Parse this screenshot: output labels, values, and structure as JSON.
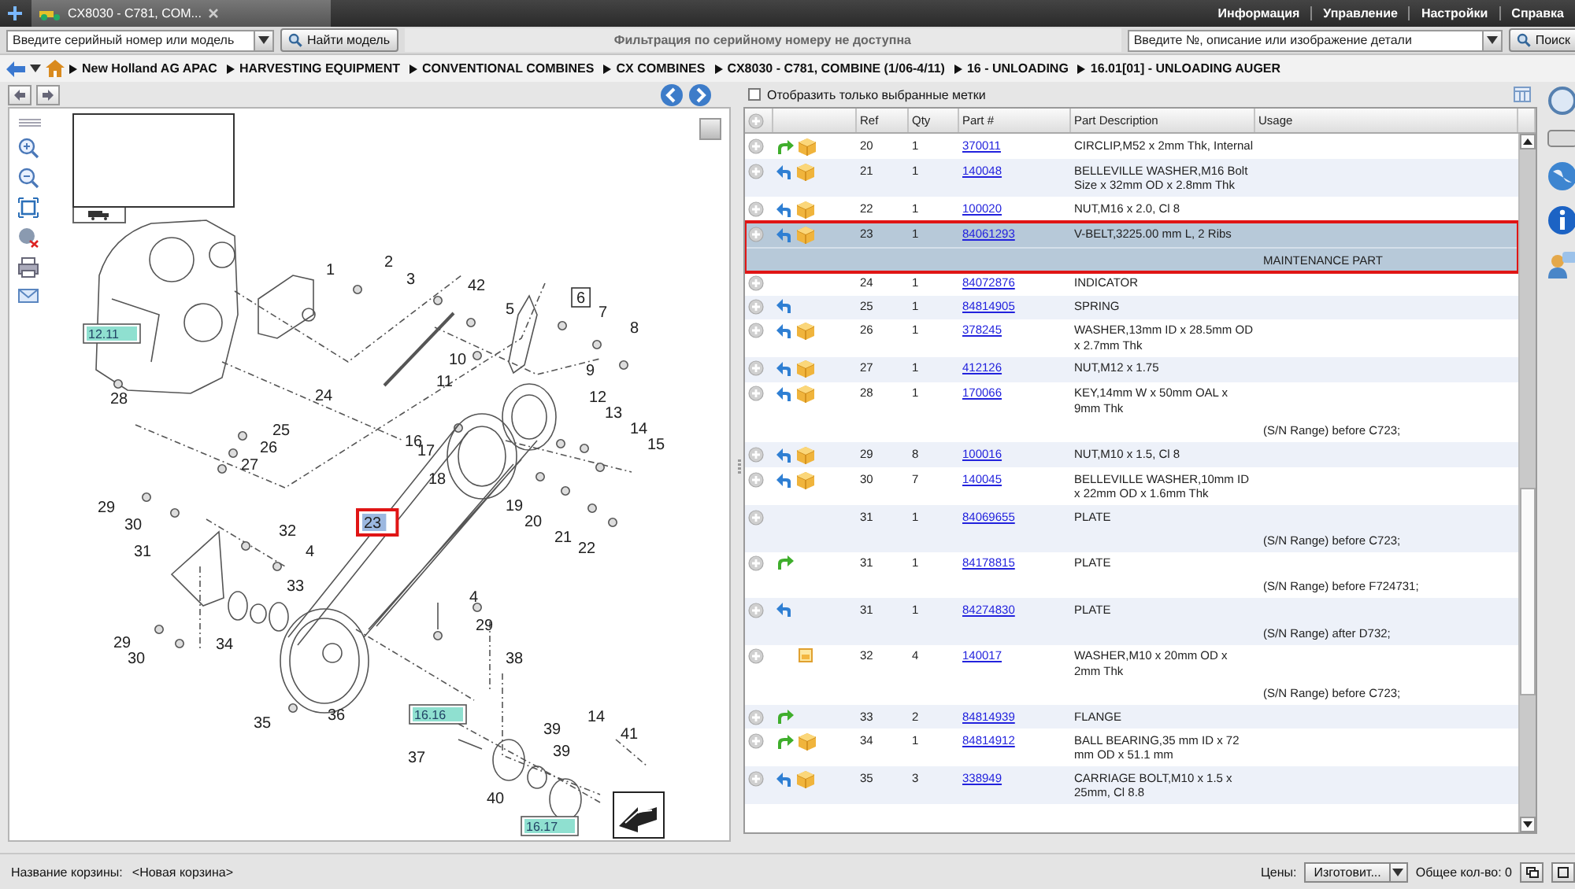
{
  "tabs": [
    {
      "label": "CX8030 - C781, COM...",
      "selected": true
    }
  ],
  "top_menu": [
    "Информация",
    "Управление",
    "Настройки",
    "Справка"
  ],
  "search_bar": {
    "model_field": {
      "placeholder": "Введите серийный номер или модель"
    },
    "model_button": "Найти модель",
    "notice": "Фильтрация по серийному номеру не доступна",
    "part_field": {
      "placeholder": "Введите №, описание или изображение детали"
    },
    "search_button": "Поиск"
  },
  "breadcrumbs": [
    "New Holland AG APAC",
    "HARVESTING EQUIPMENT",
    "CONVENTIONAL COMBINES",
    "CX COMBINES",
    "CX8030 - C781, COMBINE (1/06-4/11)",
    "16 - UNLOADING",
    "16.01[01] - UNLOADING AUGER"
  ],
  "diagram": {
    "callouts": [
      {
        "text": "1",
        "kind": "plain"
      },
      {
        "text": "2",
        "kind": "plain"
      },
      {
        "text": "3",
        "kind": "plain"
      },
      {
        "text": "42",
        "kind": "plain"
      },
      {
        "text": "5",
        "kind": "plain"
      },
      {
        "text": "6",
        "kind": "boxed"
      },
      {
        "text": "7",
        "kind": "plain"
      },
      {
        "text": "12.11",
        "kind": "reference"
      },
      {
        "text": "8",
        "kind": "plain"
      },
      {
        "text": "10",
        "kind": "plain"
      },
      {
        "text": "11",
        "kind": "plain"
      },
      {
        "text": "9",
        "kind": "plain"
      },
      {
        "text": "28",
        "kind": "plain"
      },
      {
        "text": "24",
        "kind": "plain"
      },
      {
        "text": "12",
        "kind": "plain"
      },
      {
        "text": "13",
        "kind": "plain"
      },
      {
        "text": "25",
        "kind": "plain"
      },
      {
        "text": "14",
        "kind": "plain"
      },
      {
        "text": "26",
        "kind": "plain"
      },
      {
        "text": "16",
        "kind": "plain"
      },
      {
        "text": "17",
        "kind": "plain"
      },
      {
        "text": "15",
        "kind": "plain"
      },
      {
        "text": "27",
        "kind": "plain"
      },
      {
        "text": "18",
        "kind": "plain"
      },
      {
        "text": "29",
        "kind": "plain"
      },
      {
        "text": "19",
        "kind": "plain"
      },
      {
        "text": "30",
        "kind": "plain"
      },
      {
        "text": "32",
        "kind": "plain"
      },
      {
        "text": "23",
        "kind": "highlighted"
      },
      {
        "text": "20",
        "kind": "plain"
      },
      {
        "text": "31",
        "kind": "plain"
      },
      {
        "text": "4",
        "kind": "plain"
      },
      {
        "text": "21",
        "kind": "plain"
      },
      {
        "text": "22",
        "kind": "plain"
      },
      {
        "text": "33",
        "kind": "plain"
      },
      {
        "text": "4",
        "kind": "plain"
      },
      {
        "text": "29",
        "kind": "plain"
      },
      {
        "text": "29",
        "kind": "plain"
      },
      {
        "text": "30",
        "kind": "plain"
      },
      {
        "text": "34",
        "kind": "plain"
      },
      {
        "text": "38",
        "kind": "plain"
      },
      {
        "text": "35",
        "kind": "plain"
      },
      {
        "text": "36",
        "kind": "plain"
      },
      {
        "text": "16.16",
        "kind": "reference"
      },
      {
        "text": "39",
        "kind": "plain"
      },
      {
        "text": "14",
        "kind": "plain"
      },
      {
        "text": "41",
        "kind": "plain"
      },
      {
        "text": "37",
        "kind": "plain"
      },
      {
        "text": "39",
        "kind": "plain"
      },
      {
        "text": "40",
        "kind": "plain"
      },
      {
        "text": "16.17",
        "kind": "reference"
      }
    ]
  },
  "parts_panel": {
    "filter_checkbox": {
      "label": "Отобразить только выбранные метки",
      "checked": false
    },
    "table": {
      "columns": [
        "Ref",
        "Qty",
        "Part #",
        "Part Description",
        "Usage"
      ],
      "rows": [
        {
          "ref": "20",
          "qty": "1",
          "part": "370011",
          "description": "CIRCLIP,M52 x 2mm Thk, Internal",
          "back_arrow": false,
          "forward_arrow": true,
          "box": true,
          "note": false,
          "selected": false
        },
        {
          "ref": "21",
          "qty": "1",
          "part": "140048",
          "description": "BELLEVILLE WASHER,M16 Bolt Size x 32mm OD x 2.8mm Thk",
          "back_arrow": true,
          "forward_arrow": false,
          "box": true,
          "note": false,
          "selected": false
        },
        {
          "ref": "22",
          "qty": "1",
          "part": "100020",
          "description": "NUT,M16 x 2.0, Cl 8",
          "back_arrow": true,
          "forward_arrow": false,
          "box": true,
          "note": false,
          "selected": false
        },
        {
          "ref": "23",
          "qty": "1",
          "part": "84061293",
          "description": "V-BELT,3225.00 mm L, 2 Ribs",
          "usage": "MAINTENANCE PART",
          "back_arrow": true,
          "forward_arrow": false,
          "box": true,
          "note": false,
          "selected": true
        },
        {
          "ref": "24",
          "qty": "1",
          "part": "84072876",
          "description": "INDICATOR",
          "back_arrow": false,
          "forward_arrow": false,
          "box": false,
          "note": false,
          "selected": false
        },
        {
          "ref": "25",
          "qty": "1",
          "part": "84814905",
          "description": "SPRING",
          "back_arrow": true,
          "forward_arrow": false,
          "box": false,
          "note": false,
          "selected": false
        },
        {
          "ref": "26",
          "qty": "1",
          "part": "378245",
          "description": "WASHER,13mm ID x 28.5mm OD x 2.7mm Thk",
          "back_arrow": true,
          "forward_arrow": false,
          "box": true,
          "note": false,
          "selected": false
        },
        {
          "ref": "27",
          "qty": "1",
          "part": "412126",
          "description": "NUT,M12 x 1.75",
          "back_arrow": true,
          "forward_arrow": false,
          "box": true,
          "note": false,
          "selected": false
        },
        {
          "ref": "28",
          "qty": "1",
          "part": "170066",
          "description": "KEY,14mm W x 50mm OAL x 9mm Thk",
          "usage": "(S/N Range) before C723;",
          "back_arrow": true,
          "forward_arrow": false,
          "box": true,
          "note": false,
          "selected": false
        },
        {
          "ref": "29",
          "qty": "8",
          "part": "100016",
          "description": "NUT,M10 x 1.5, Cl 8",
          "back_arrow": true,
          "forward_arrow": false,
          "box": true,
          "note": false,
          "selected": false
        },
        {
          "ref": "30",
          "qty": "7",
          "part": "140045",
          "description": "BELLEVILLE WASHER,10mm ID x 22mm OD x 1.6mm Thk",
          "back_arrow": true,
          "forward_arrow": false,
          "box": true,
          "note": false,
          "selected": false
        },
        {
          "ref": "31",
          "qty": "1",
          "part": "84069655",
          "description": "PLATE",
          "usage": "(S/N Range) before C723;",
          "back_arrow": false,
          "forward_arrow": false,
          "box": false,
          "note": false,
          "selected": false
        },
        {
          "ref": "31",
          "qty": "1",
          "part": "84178815",
          "description": "PLATE",
          "usage": "(S/N Range) before F724731;",
          "back_arrow": false,
          "forward_arrow": true,
          "box": false,
          "note": false,
          "selected": false
        },
        {
          "ref": "31",
          "qty": "1",
          "part": "84274830",
          "description": "PLATE",
          "usage": "(S/N Range) after D732;",
          "back_arrow": true,
          "forward_arrow": false,
          "box": false,
          "note": false,
          "selected": false
        },
        {
          "ref": "32",
          "qty": "4",
          "part": "140017",
          "description": "WASHER,M10 x 20mm OD x 2mm Thk",
          "usage": "(S/N Range) before C723;",
          "back_arrow": false,
          "forward_arrow": false,
          "box": false,
          "note": true,
          "selected": false
        },
        {
          "ref": "33",
          "qty": "2",
          "part": "84814939",
          "description": "FLANGE",
          "back_arrow": false,
          "forward_arrow": true,
          "box": false,
          "note": false,
          "selected": false
        },
        {
          "ref": "34",
          "qty": "1",
          "part": "84814912",
          "description": "BALL BEARING,35 mm ID x 72 mm OD x 51.1 mm",
          "back_arrow": false,
          "forward_arrow": true,
          "box": true,
          "note": false,
          "selected": false
        },
        {
          "ref": "35",
          "qty": "3",
          "part": "338949",
          "description": "CARRIAGE BOLT,M10 x 1.5 x 25mm, Cl 8.8",
          "back_arrow": true,
          "forward_arrow": false,
          "box": true,
          "note": false,
          "selected": false
        }
      ]
    }
  },
  "status_bar": {
    "basket_label": "Название корзины:",
    "basket_name": "<Новая корзина>",
    "prices_label": "Цены:",
    "prices_select": "Изготовит...",
    "total": "Общее кол-во: 0"
  }
}
